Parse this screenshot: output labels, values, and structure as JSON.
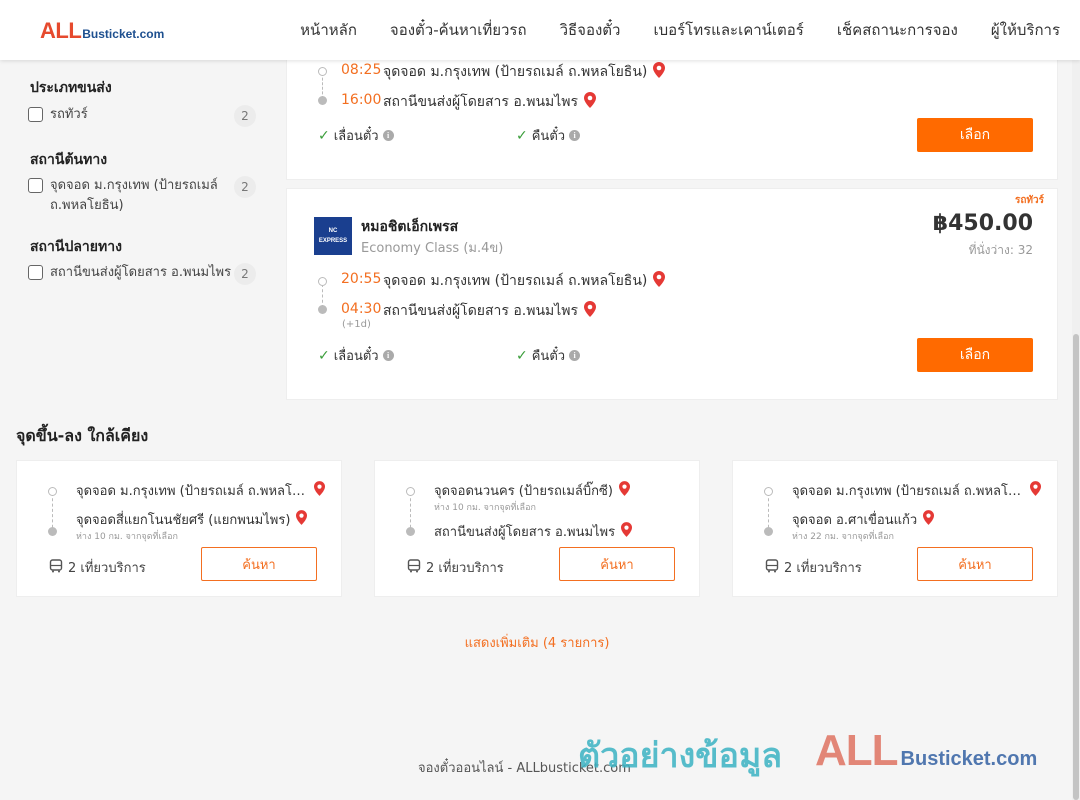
{
  "brand": {
    "logo_all": "ALL",
    "logo_rest": "Busticket.com"
  },
  "nav": [
    "หน้าหลัก",
    "จองตั๋ว-ค้นหาเที่ยวรถ",
    "วิธีจองตั๋ว",
    "เบอร์โทรและเคาน์เตอร์",
    "เช็คสถานะการจอง",
    "ผู้ให้บริการ"
  ],
  "filters": {
    "transport": {
      "title": "ประเภทขนส่ง",
      "option": "รถทัวร์",
      "count": "2"
    },
    "origin": {
      "title": "สถานีต้นทาง",
      "option": "จุดจอด ม.กรุงเทพ (ป้ายรถเมล์ ถ.พหลโยธิน)",
      "count": "2"
    },
    "destination": {
      "title": "สถานีปลายทาง",
      "option": "สถานีขนส่งผู้โดยสาร อ.พนมไพร",
      "count": "2"
    }
  },
  "trips": [
    {
      "depart_time": "08:25",
      "depart_place": "จุดจอด ม.กรุงเทพ (ป้ายรถเมล์ ถ.พหลโยธิน)",
      "arrive_time": "16:00",
      "arrive_place": "สถานีขนส่งผู้โดยสาร อ.พนมไพร",
      "perk_reschedule": "เลื่อนตั๋ว",
      "perk_refund": "คืนตั๋ว",
      "select_label": "เลือก"
    },
    {
      "operator_logo": "NC EXPRESS",
      "operator": "หมอชิตเอ็กเพรส",
      "class": "Economy Class (ม.4ข)",
      "bus_type": "รถทัวร์",
      "price": "฿450.00",
      "seats": "ที่นั่งว่าง: 32",
      "depart_time": "20:55",
      "depart_place": "จุดจอด ม.กรุงเทพ (ป้ายรถเมล์ ถ.พหลโยธิน)",
      "arrive_time": "04:30",
      "arrive_next_day": "(+1d)",
      "arrive_place": "สถานีขนส่งผู้โดยสาร อ.พนมไพร",
      "perk_reschedule": "เลื่อนตั๋ว",
      "perk_refund": "คืนตั๋ว",
      "select_label": "เลือก"
    }
  ],
  "nearby": {
    "title": "จุดขึ้น-ลง ใกล้เคียง",
    "cards": [
      {
        "from": "จุดจอด ม.กรุงเทพ (ป้ายรถเมล์ ถ.พหลโยธิน)",
        "from_dist": "",
        "to": "จุดจอดสี่แยกโนนชัยศรี (แยกพนมไพร)",
        "to_dist": "ห่าง 10 กม. จากจุดที่เลือก",
        "trips": "2 เที่ยวบริการ",
        "search_label": "ค้นหา"
      },
      {
        "from": "จุดจอดนวนคร (ป้ายรถเมล์บิ๊กซี)",
        "from_dist": "ห่าง 10 กม. จากจุดที่เลือก",
        "to": "สถานีขนส่งผู้โดยสาร อ.พนมไพร",
        "to_dist": "",
        "trips": "2 เที่ยวบริการ",
        "search_label": "ค้นหา"
      },
      {
        "from": "จุดจอด ม.กรุงเทพ (ป้ายรถเมล์ ถ.พหลโยธิน)",
        "from_dist": "",
        "to": "จุดจอด อ.ศาเขื่อนแก้ว",
        "to_dist": "ห่าง 22 กม. จากจุดที่เลือก",
        "trips": "2 เที่ยวบริการ",
        "search_label": "ค้นหา"
      }
    ],
    "show_more": "แสดงเพิ่มเติม (4 รายการ)"
  },
  "footer": {
    "text": "จองตั๋วออนไลน์ - ALLbusticket.com"
  },
  "watermark": {
    "text": "ตัวอย่างข้อมูล",
    "logo_all": "ALL",
    "logo_rest": "Busticket.com"
  },
  "colors": {
    "accent": "#ff6a00",
    "time": "#f36f21",
    "brand_red": "#e64a2e",
    "brand_blue": "#1d4f8f",
    "pin": "#e53935",
    "check": "#3a9d3a"
  },
  "icons": {
    "location": "map-pin-icon",
    "check": "check-icon",
    "info": "info-icon",
    "bus": "bus-icon"
  }
}
